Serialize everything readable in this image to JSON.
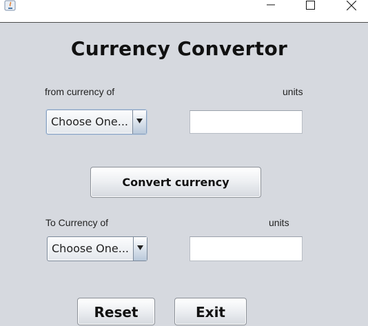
{
  "window": {
    "app_icon": "java-icon",
    "controls": {
      "minimize_icon": "minimize-icon",
      "maximize_icon": "maximize-icon",
      "close_icon": "close-icon"
    }
  },
  "form": {
    "title": "Currency Convertor",
    "from": {
      "label": "from currency of",
      "units_label": "units",
      "select_value": "Choose One...",
      "amount_value": ""
    },
    "convert_button": "Convert currency",
    "to": {
      "label": "To Currency of",
      "units_label": "units",
      "select_value": "Choose One...",
      "amount_value": ""
    },
    "reset_button": "Reset",
    "exit_button": "Exit"
  }
}
